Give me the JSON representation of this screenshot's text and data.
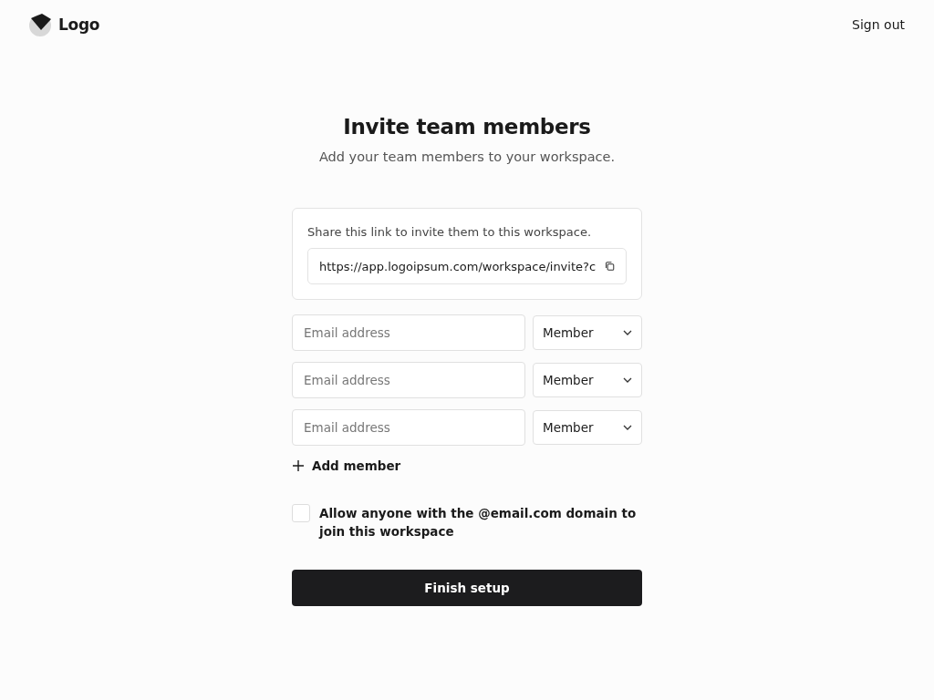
{
  "header": {
    "logo": "Logo",
    "sign_out": "Sign out"
  },
  "title": "Invite team members",
  "subtitle": "Add your team members to your workspace.",
  "share": {
    "label": "Share this link to invite them to this workspace.",
    "link": "https://app.logoipsum.com/workspace/invite?c"
  },
  "members": [
    {
      "placeholder": "Email address",
      "role": "Member"
    },
    {
      "placeholder": "Email address",
      "role": "Member"
    },
    {
      "placeholder": "Email address",
      "role": "Member"
    }
  ],
  "add_member": "Add member",
  "allow_domain": {
    "label": "Allow anyone with the @email.com domain to join this workspace",
    "checked": false
  },
  "finish": "Finish setup"
}
